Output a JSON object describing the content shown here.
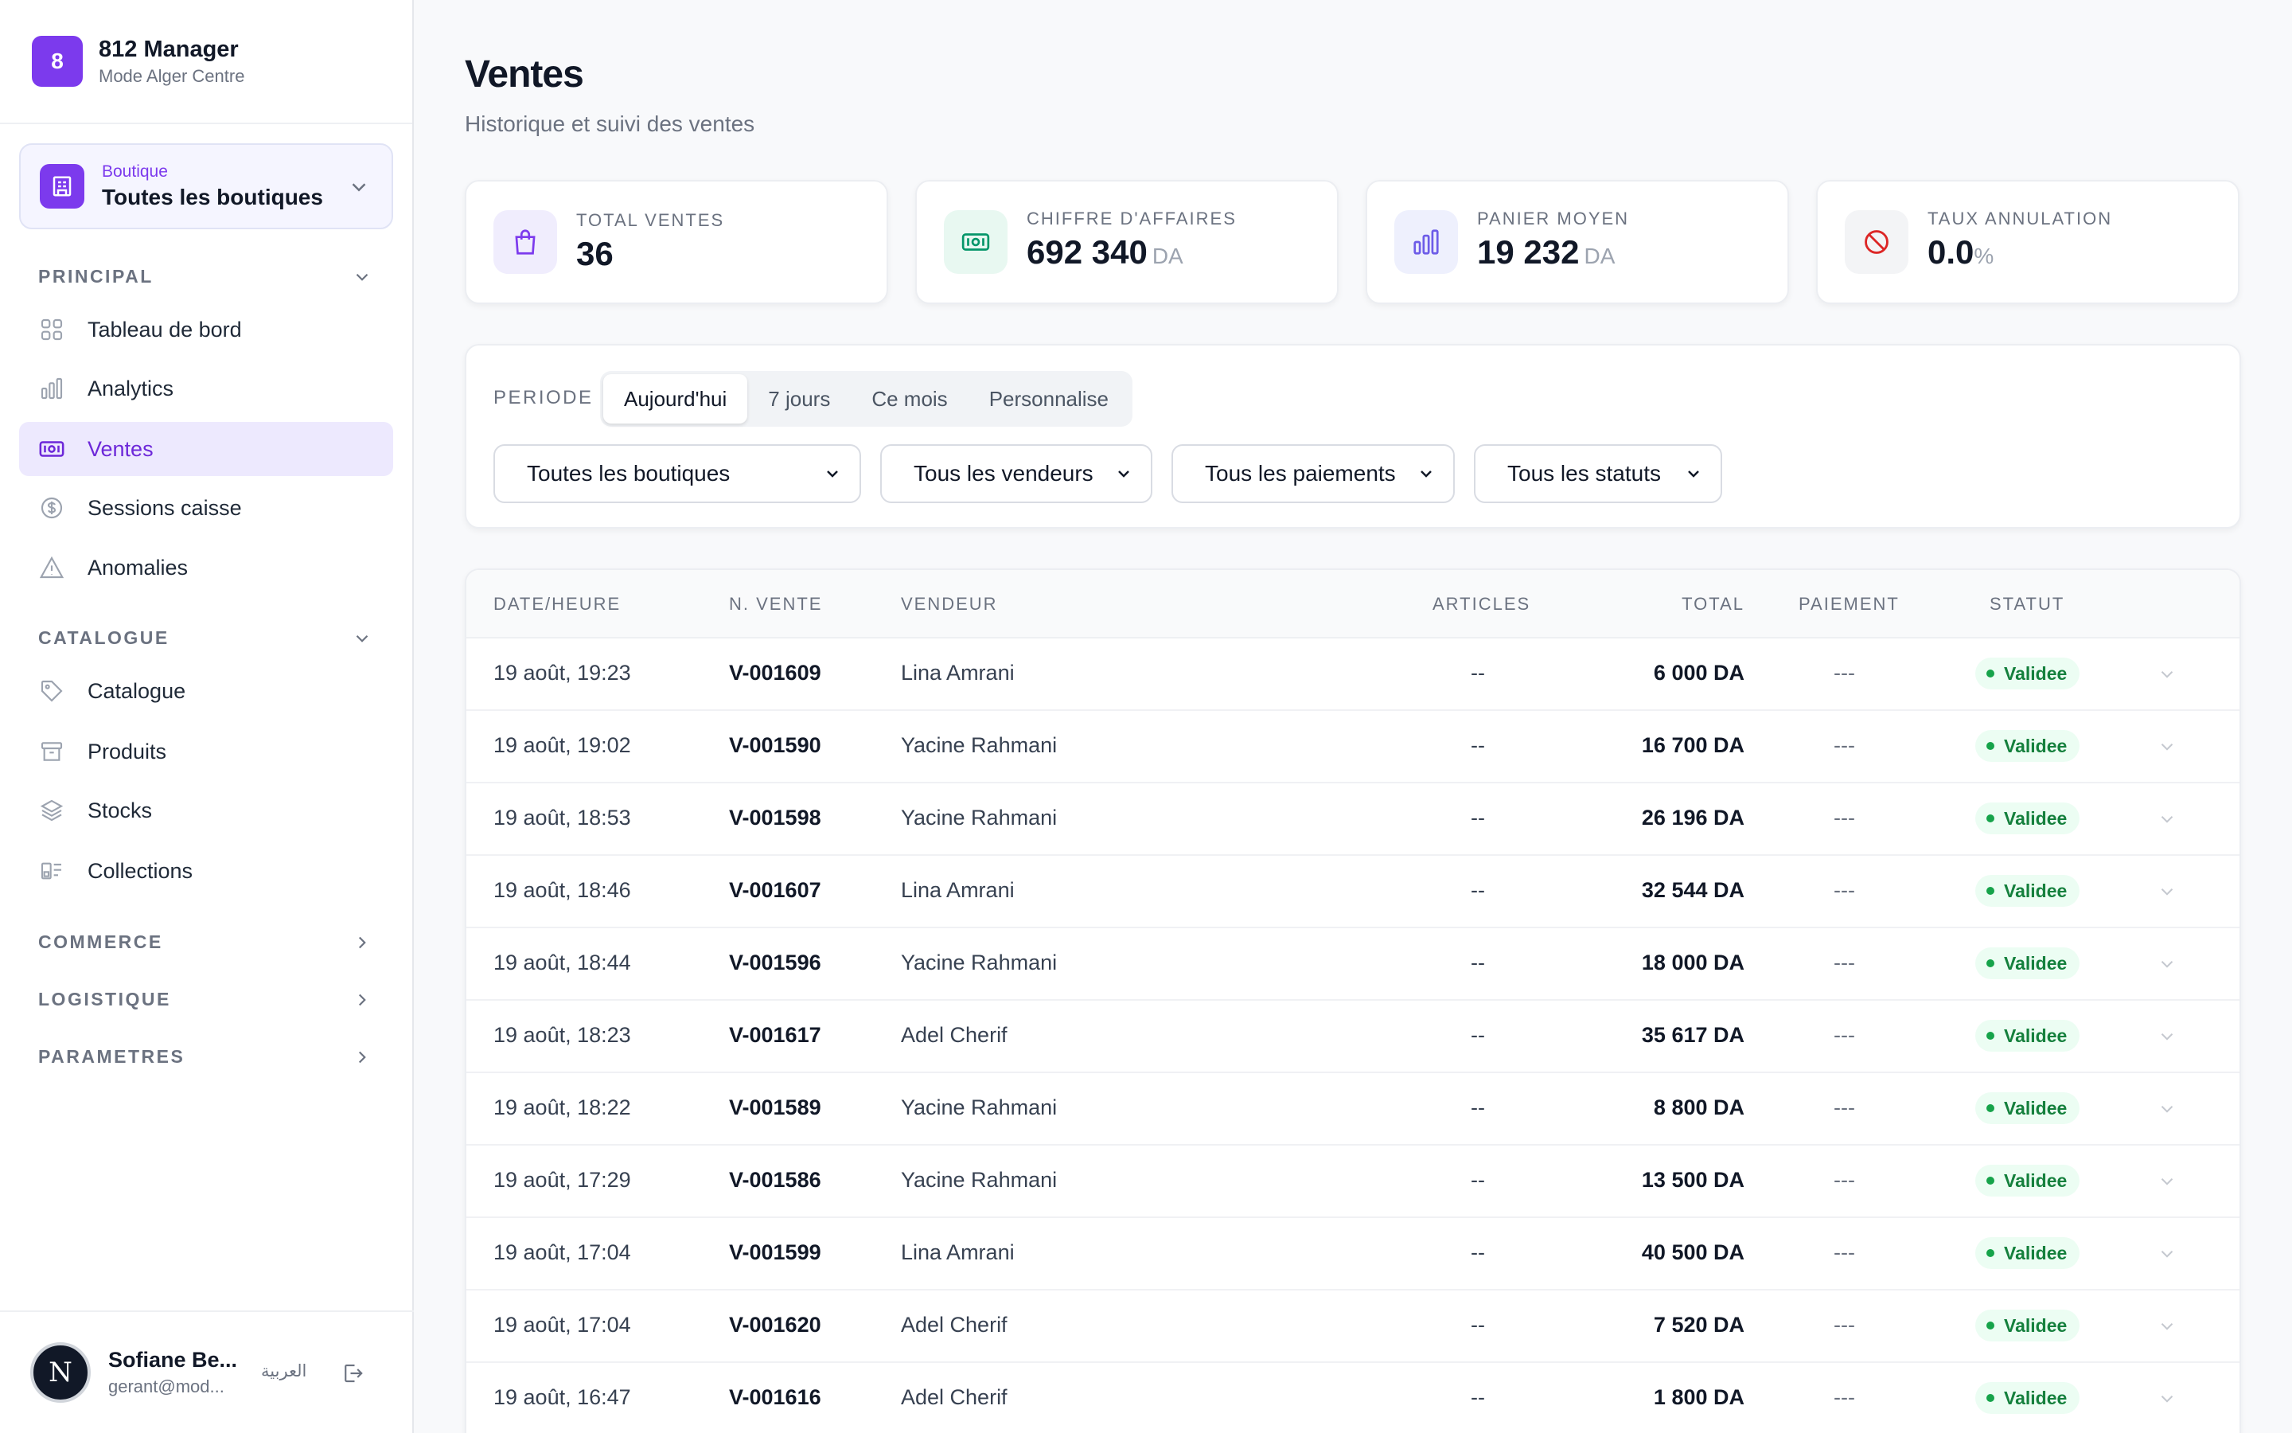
{
  "brand": {
    "logo_letter": "8",
    "name": "812 Manager",
    "subtitle": "Mode Alger Centre"
  },
  "store_selector": {
    "label": "Boutique",
    "value": "Toutes les boutiques"
  },
  "sidebar": {
    "principal": {
      "title": "PRINCIPAL",
      "items": [
        {
          "label": "Tableau de bord",
          "icon": "grid-icon"
        },
        {
          "label": "Analytics",
          "icon": "bar-chart-icon"
        },
        {
          "label": "Ventes",
          "icon": "banknote-icon",
          "active": true
        },
        {
          "label": "Sessions caisse",
          "icon": "dollar-circle-icon"
        },
        {
          "label": "Anomalies",
          "icon": "warning-triangle-icon"
        }
      ]
    },
    "catalogue": {
      "title": "CATALOGUE",
      "items": [
        {
          "label": "Catalogue",
          "icon": "tag-icon"
        },
        {
          "label": "Produits",
          "icon": "archive-box-icon"
        },
        {
          "label": "Stocks",
          "icon": "layers-icon"
        },
        {
          "label": "Collections",
          "icon": "collection-icon"
        }
      ]
    },
    "commerce": {
      "title": "COMMERCE"
    },
    "logistique": {
      "title": "LOGISTIQUE"
    },
    "parametres": {
      "title": "PARAMETRES"
    }
  },
  "user": {
    "initial": "N",
    "name": "Sofiane Be...",
    "email": "gerant@mod...",
    "lang_switch": "العربية"
  },
  "page": {
    "title": "Ventes",
    "subtitle": "Historique et suivi des ventes"
  },
  "kpis": [
    {
      "label": "TOTAL VENTES",
      "value": "36",
      "unit": "",
      "icon": "shopping-bag-icon",
      "color": "#7c3aed",
      "bg": "#f0edfd"
    },
    {
      "label": "CHIFFRE D'AFFAIRES",
      "value": "692 340",
      "unit": "DA",
      "icon": "banknote-icon",
      "color": "#059669",
      "bg": "#e8f8f1"
    },
    {
      "label": "PANIER MOYEN",
      "value": "19 232",
      "unit": "DA",
      "icon": "bar-chart-icon",
      "color": "#6d5ce8",
      "bg": "#eef0fd"
    },
    {
      "label": "TAUX ANNULATION",
      "value": "0.0",
      "unit": "%",
      "icon": "ban-icon",
      "color": "#dc2626",
      "bg": "#f3f4f6"
    }
  ],
  "filters": {
    "periode_label": "PERIODE",
    "periods": [
      "Aujourd'hui",
      "7 jours",
      "Ce mois",
      "Personnalise"
    ],
    "selected_period": "Aujourd'hui",
    "selects": [
      "Toutes les boutiques",
      "Tous les vendeurs",
      "Tous les paiements",
      "Tous les statuts"
    ]
  },
  "table": {
    "columns": [
      "DATE/HEURE",
      "N. VENTE",
      "VENDEUR",
      "ARTICLES",
      "TOTAL",
      "PAIEMENT",
      "STATUT"
    ],
    "rows": [
      {
        "date": "19 août, 19:23",
        "num": "V-001609",
        "vendeur": "Lina Amrani",
        "articles": "--",
        "total": "6 000 DA",
        "paiement": "---",
        "statut": "Validee"
      },
      {
        "date": "19 août, 19:02",
        "num": "V-001590",
        "vendeur": "Yacine Rahmani",
        "articles": "--",
        "total": "16 700 DA",
        "paiement": "---",
        "statut": "Validee"
      },
      {
        "date": "19 août, 18:53",
        "num": "V-001598",
        "vendeur": "Yacine Rahmani",
        "articles": "--",
        "total": "26 196 DA",
        "paiement": "---",
        "statut": "Validee"
      },
      {
        "date": "19 août, 18:46",
        "num": "V-001607",
        "vendeur": "Lina Amrani",
        "articles": "--",
        "total": "32 544 DA",
        "paiement": "---",
        "statut": "Validee"
      },
      {
        "date": "19 août, 18:44",
        "num": "V-001596",
        "vendeur": "Yacine Rahmani",
        "articles": "--",
        "total": "18 000 DA",
        "paiement": "---",
        "statut": "Validee"
      },
      {
        "date": "19 août, 18:23",
        "num": "V-001617",
        "vendeur": "Adel Cherif",
        "articles": "--",
        "total": "35 617 DA",
        "paiement": "---",
        "statut": "Validee"
      },
      {
        "date": "19 août, 18:22",
        "num": "V-001589",
        "vendeur": "Yacine Rahmani",
        "articles": "--",
        "total": "8 800 DA",
        "paiement": "---",
        "statut": "Validee"
      },
      {
        "date": "19 août, 17:29",
        "num": "V-001586",
        "vendeur": "Yacine Rahmani",
        "articles": "--",
        "total": "13 500 DA",
        "paiement": "---",
        "statut": "Validee"
      },
      {
        "date": "19 août, 17:04",
        "num": "V-001599",
        "vendeur": "Lina Amrani",
        "articles": "--",
        "total": "40 500 DA",
        "paiement": "---",
        "statut": "Validee"
      },
      {
        "date": "19 août, 17:04",
        "num": "V-001620",
        "vendeur": "Adel Cherif",
        "articles": "--",
        "total": "7 520 DA",
        "paiement": "---",
        "statut": "Validee"
      },
      {
        "date": "19 août, 16:47",
        "num": "V-001616",
        "vendeur": "Adel Cherif",
        "articles": "--",
        "total": "1 800 DA",
        "paiement": "---",
        "statut": "Validee"
      }
    ]
  }
}
